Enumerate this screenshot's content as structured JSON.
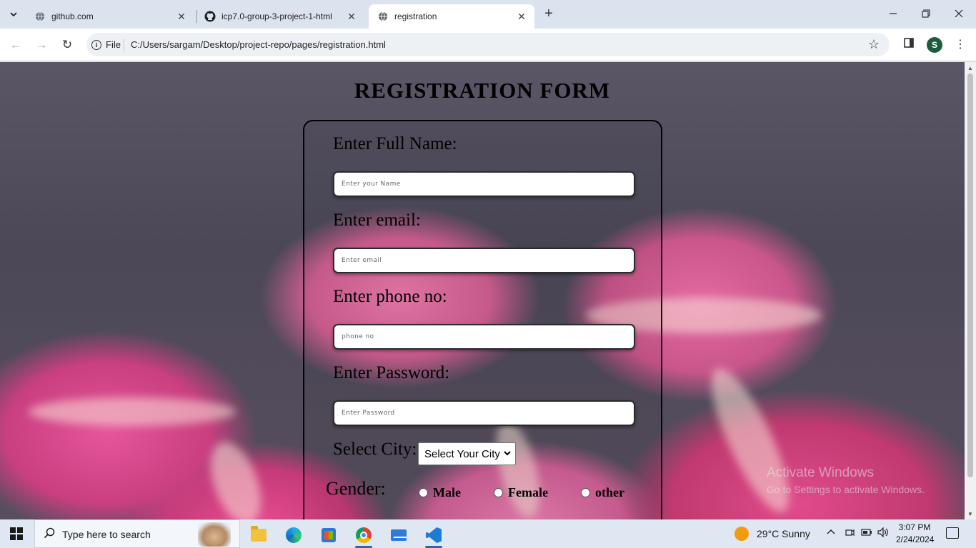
{
  "browser": {
    "tabs": [
      {
        "title": "github.com",
        "active": false
      },
      {
        "title": "icp7.0-group-3-project-1-html",
        "active": false
      },
      {
        "title": "registration",
        "active": true
      }
    ],
    "address": {
      "scheme_label": "File",
      "url": "C:/Users/sargam/Desktop/project-repo/pages/registration.html"
    },
    "profile_initial": "S"
  },
  "page": {
    "title": "REGISTRATION FORM",
    "fields": {
      "name_label": "Enter Full Name:",
      "name_placeholder": "Enter your Name",
      "email_label": "Enter email:",
      "email_placeholder": "Enter email",
      "phone_label": "Enter phone no:",
      "phone_placeholder": "phone no",
      "password_label": "Enter Password:",
      "password_placeholder": "Enter Password",
      "city_label": "Select City:",
      "city_selected": "Select Your City",
      "gender_label": "Gender:",
      "gender_options": [
        "Male",
        "Female",
        "other"
      ]
    },
    "watermark": {
      "line1": "Activate Windows",
      "line2": "Go to Settings to activate Windows."
    }
  },
  "taskbar": {
    "search_placeholder": "Type here to search",
    "weather": "29°C  Sunny",
    "time": "3:07 PM",
    "date": "2/24/2024"
  },
  "colors": {
    "tabbar_bg": "#dbe3ef",
    "taskbar_bg": "#dfe7f2",
    "profile_bg": "#1d5c3c"
  }
}
